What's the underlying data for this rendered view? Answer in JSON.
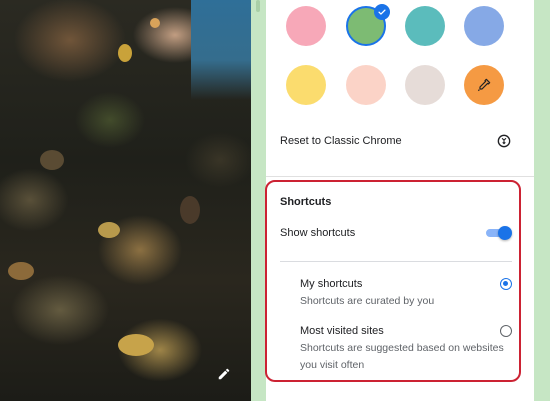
{
  "background": {
    "edit_icon": "pencil-icon"
  },
  "colors": {
    "swatches": [
      {
        "name": "pink",
        "color": "#f7a8b8",
        "selected": false
      },
      {
        "name": "green",
        "color": "#7dbb73",
        "selected": true
      },
      {
        "name": "teal",
        "color": "#5bbcbc",
        "selected": false
      },
      {
        "name": "blue",
        "color": "#86a9e6",
        "selected": false
      },
      {
        "name": "yellow",
        "color": "#fbdc6e",
        "selected": false
      },
      {
        "name": "peach",
        "color": "#fbd3c7",
        "selected": false
      },
      {
        "name": "gray",
        "color": "#e6dcd8",
        "selected": false
      },
      {
        "name": "custom",
        "color": "#f59a43",
        "selected": false,
        "icon": "eyedropper-icon"
      }
    ],
    "accent": "#1a73e8",
    "highlight_border": "#cc2233"
  },
  "reset": {
    "label": "Reset to Classic Chrome",
    "icon": "reset-icon"
  },
  "shortcuts": {
    "title": "Shortcuts",
    "show_label": "Show shortcuts",
    "show_enabled": true,
    "options": [
      {
        "title": "My shortcuts",
        "desc": "Shortcuts are curated by you",
        "checked": true
      },
      {
        "title": "Most visited sites",
        "desc": "Shortcuts are suggested based on websites you visit often",
        "checked": false
      }
    ]
  }
}
